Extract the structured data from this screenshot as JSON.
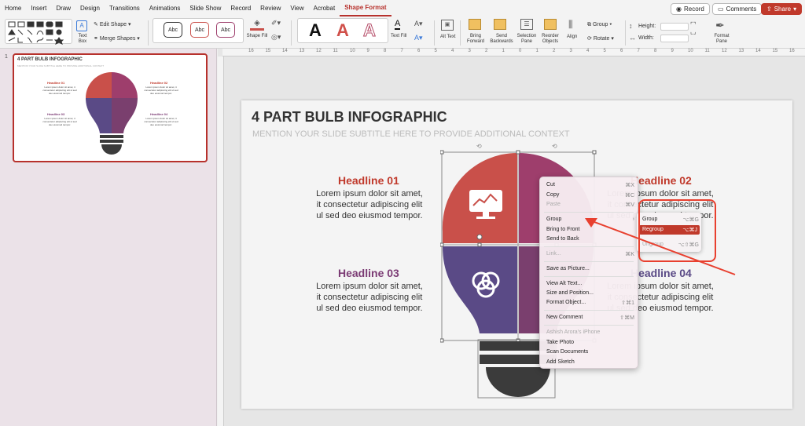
{
  "menu_tabs": [
    "Home",
    "Insert",
    "Draw",
    "Design",
    "Transitions",
    "Animations",
    "Slide Show",
    "Record",
    "Review",
    "View",
    "Acrobat",
    "Shape Format"
  ],
  "actions": {
    "record": "Record",
    "comments": "Comments",
    "share": "Share"
  },
  "ribbon": {
    "text_box": "Text Box",
    "edit_shape": "Edit Shape",
    "merge_shapes": "Merge Shapes",
    "style_abc": "Abc",
    "shape_fill": "Shape Fill",
    "text_fill": "Text Fill",
    "alt_text": "Alt Text",
    "bring_forward": "Bring Forward",
    "send_backwards": "Send Backwards",
    "selection_pane": "Selection Pane",
    "reorder_objects": "Reorder Objects",
    "align": "Align",
    "group": "Group",
    "rotate": "Rotate",
    "height": "Height:",
    "width": "Width:",
    "format_pane": "Format Pane",
    "wordart_a": "A"
  },
  "thumbnail": {
    "number": "1",
    "title": "4 PART BULB INFOGRAPHIC",
    "subtitle": "MENTION YOUR SLIDE SUBTITLE HERE TO PROVIDE ADDITIONAL CONTEXT",
    "h1": "Headline 01",
    "h2": "Headline 02",
    "h3": "Headline 03",
    "h4": "Headline 04",
    "body": "Lorem ipsum dolor sit amet, it consectetur adipiscing elit ul sed deo eiusmod tempor."
  },
  "ruler_numbers": [
    "16",
    "15",
    "14",
    "13",
    "12",
    "11",
    "10",
    "9",
    "8",
    "7",
    "6",
    "5",
    "4",
    "3",
    "2",
    "1",
    "0",
    "1",
    "2",
    "3",
    "4",
    "5",
    "6",
    "7",
    "8",
    "9",
    "10",
    "11",
    "12",
    "13",
    "14",
    "15",
    "16"
  ],
  "slide": {
    "title": "4 PART BULB INFOGRAPHIC",
    "subtitle": "MENTION YOUR SLIDE SUBTITLE HERE TO PROVIDE ADDITIONAL CONTEXT",
    "h1": "Headline 01",
    "h2": "Headline 02",
    "h3": "Headline 03",
    "h4": "Headline 04",
    "body": "Lorem ipsum dolor sit amet, it consectetur adipiscing elit ul sed deo eiusmod tempor.",
    "body_right_partial": "Lorem ipsum dolor sit amet, it consectetur adipiscing elit ul sed deo eiusmod tempor.",
    "colors": {
      "red": "#c9504a",
      "magenta": "#9e3e6c",
      "purple": "#5a4a86",
      "plum": "#7a3f6e",
      "base": "#3b3b3b",
      "h_red": "#c0392b",
      "h_purple": "#7b3b74"
    }
  },
  "context_menu": {
    "items": [
      {
        "label": "Cut",
        "shortcut": "⌘X",
        "disabled": false
      },
      {
        "label": "Copy",
        "shortcut": "⌘C",
        "disabled": false
      },
      {
        "label": "Paste",
        "shortcut": "⌘V",
        "disabled": true
      },
      {
        "label": "Group",
        "shortcut": "",
        "disabled": false,
        "submenu": true
      },
      {
        "label": "Bring to Front",
        "shortcut": "",
        "disabled": false
      },
      {
        "label": "Send to Back",
        "shortcut": "",
        "disabled": false
      },
      {
        "label": "Link...",
        "shortcut": "⌘K",
        "disabled": true
      },
      {
        "label": "Save as Picture...",
        "shortcut": "",
        "disabled": false
      },
      {
        "label": "View Alt Text...",
        "shortcut": "",
        "disabled": false
      },
      {
        "label": "Size and Position...",
        "shortcut": "",
        "disabled": false
      },
      {
        "label": "Format Object...",
        "shortcut": "⇧⌘1",
        "disabled": false
      },
      {
        "label": "New Comment",
        "shortcut": "⇧⌘M",
        "disabled": false
      },
      {
        "label": "Ashish Arora's iPhone",
        "shortcut": "",
        "disabled": true
      },
      {
        "label": "Take Photo",
        "shortcut": "",
        "disabled": false
      },
      {
        "label": "Scan Documents",
        "shortcut": "",
        "disabled": false
      },
      {
        "label": "Add Sketch",
        "shortcut": "",
        "disabled": false
      }
    ]
  },
  "submenu": {
    "items": [
      {
        "label": "Group",
        "shortcut": "⌥⌘G",
        "state": "normal"
      },
      {
        "label": "Regroup",
        "shortcut": "⌥⌘J",
        "state": "highlighted"
      },
      {
        "label": "Ungroup",
        "shortcut": "⌥⇧⌘G",
        "state": "disabled"
      }
    ]
  }
}
